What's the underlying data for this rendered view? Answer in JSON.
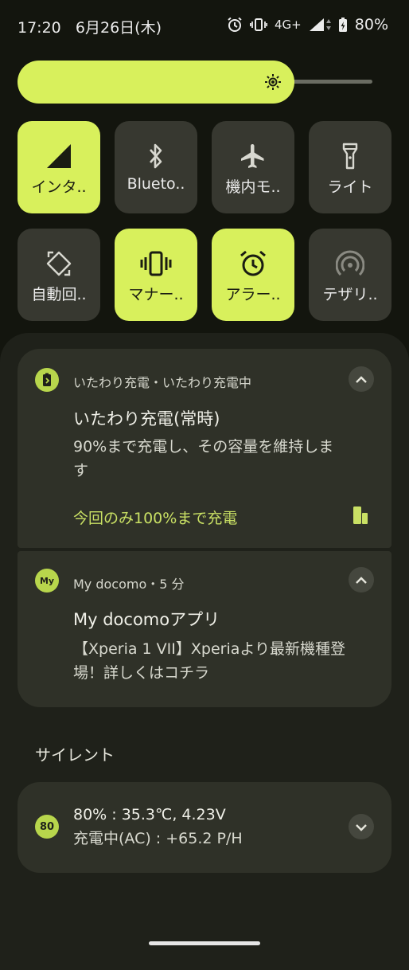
{
  "status_bar": {
    "time": "17:20",
    "date": "6月26日(木)",
    "network": "4G+",
    "battery": "80%"
  },
  "brightness": {
    "level": 0.78,
    "icon": "brightness-icon"
  },
  "tiles": [
    {
      "label": "インタ..",
      "icon": "signal-icon",
      "active": true
    },
    {
      "label": "Blueto..",
      "icon": "bluetooth-icon",
      "active": false
    },
    {
      "label": "機内モ..",
      "icon": "airplane-icon",
      "active": false
    },
    {
      "label": "ライト",
      "icon": "flashlight-icon",
      "active": false
    },
    {
      "label": "自動回..",
      "icon": "auto-rotate-icon",
      "active": false
    },
    {
      "label": "マナー..",
      "icon": "vibrate-icon",
      "active": true
    },
    {
      "label": "アラー..",
      "icon": "alarm-icon",
      "active": true
    },
    {
      "label": "テザリ..",
      "icon": "hotspot-icon",
      "active": false
    }
  ],
  "notifications": [
    {
      "app_header": "いたわり充電・いたわり充電中",
      "title": "いたわり充電(常時)",
      "body_line1": "90%まで充電し、その容量を維持しま",
      "body_line2": "す",
      "action": "今回のみ100%まで充電"
    },
    {
      "app_icon_text": "My",
      "app_header": "My docomo・5 分",
      "title": "My docomoアプリ",
      "body_line1": "【Xperia 1 VII】Xperiaより最新機種登",
      "body_line2": "場！詳しくはコチラ"
    }
  ],
  "silent_section": {
    "header": "サイレント",
    "battery_notification": {
      "icon_text": "80",
      "line1": "80% : 35.3℃, 4.23V",
      "line2": "充電中(AC) : +65.2 P/H"
    }
  },
  "colors": {
    "accent": "#d8f05c",
    "tile_inactive": "#373830",
    "card": "#2f3128",
    "background": "#13150e"
  }
}
